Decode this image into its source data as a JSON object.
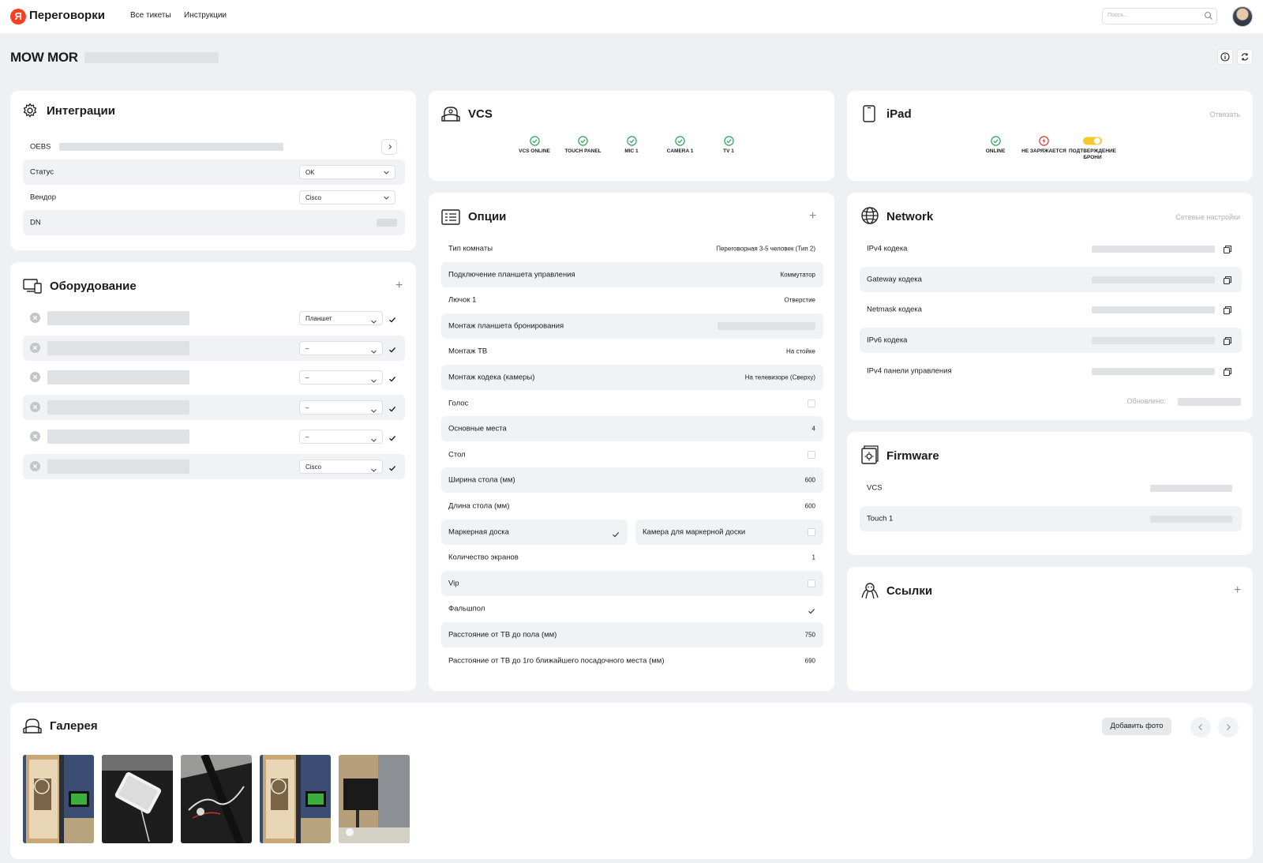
{
  "header": {
    "app_title": "Переговорки",
    "logo_letter": "Я",
    "nav": [
      "Все тикеты",
      "Инструкции"
    ],
    "search_placeholder": "Поиск..."
  },
  "page": {
    "title": "MOW MOR"
  },
  "integrations": {
    "title": "Интеграции",
    "rows": [
      {
        "label": "OEBS"
      },
      {
        "label": "Статус",
        "value": "OK"
      },
      {
        "label": "Вендор",
        "value": "Cisco"
      },
      {
        "label": "DN"
      }
    ]
  },
  "equipment": {
    "title": "Оборудование",
    "rows": [
      {
        "type": "Планшет"
      },
      {
        "type": "–"
      },
      {
        "type": "–"
      },
      {
        "type": "–"
      },
      {
        "type": "–"
      },
      {
        "type": "Cisco"
      }
    ]
  },
  "vcs": {
    "title": "VCS",
    "statuses": [
      {
        "label": "VCS ONLINE",
        "state": "ok"
      },
      {
        "label": "TOUCH PANEL",
        "state": "ok"
      },
      {
        "label": "MIC 1",
        "state": "ok"
      },
      {
        "label": "CAMERA 1",
        "state": "ok"
      },
      {
        "label": "TV 1",
        "state": "ok"
      }
    ]
  },
  "ipad": {
    "title": "iPad",
    "action": "Отвязать",
    "statuses": [
      {
        "label": "ONLINE",
        "state": "ok"
      },
      {
        "label": "НЕ ЗАРЯЖАЕТСЯ",
        "state": "error"
      },
      {
        "label": "ПОДТВЕРЖДЕНИЕ БРОНИ",
        "state": "on"
      }
    ]
  },
  "options": {
    "title": "Опции",
    "rows": [
      {
        "label": "Тип комнаты",
        "value": "Переговорная 3-5 человек (Тип 2)"
      },
      {
        "label": "Подключение планшета управления",
        "value": "Коммутатор"
      },
      {
        "label": "Лючок 1",
        "value": "Отверстие"
      },
      {
        "label": "Монтаж планшета бронирования",
        "value": ""
      },
      {
        "label": "Монтаж ТВ",
        "value": "На стойке"
      },
      {
        "label": "Монтаж кодека (камеры)",
        "value": "На телевизоре (Сверху)"
      },
      {
        "label": "Голос",
        "checked": false
      },
      {
        "label": "Основные места",
        "value": "4"
      },
      {
        "label": "Стол",
        "checked": false
      },
      {
        "label": "Ширина стола (мм)",
        "value": "600"
      },
      {
        "label": "Длина стола (мм)",
        "value": "600"
      },
      {
        "label": "Маркерная доска",
        "checked": true,
        "pair_label": "Камера для маркерной доски",
        "pair_checked": false
      },
      {
        "label": "Количество экранов",
        "value": "1"
      },
      {
        "label": "Vip",
        "checked": false
      },
      {
        "label": "Фальшпол",
        "checked": true
      },
      {
        "label": "Расстояние от ТВ до пола (мм)",
        "value": "750"
      },
      {
        "label": "Расстояние от ТВ до 1го ближайшего посадочного места (мм)",
        "value": "690"
      }
    ]
  },
  "network": {
    "title": "Network",
    "action": "Сетевые настройки",
    "rows": [
      {
        "label": "IPv4 кодека"
      },
      {
        "label": "Gateway кодека"
      },
      {
        "label": "Netmask кодека"
      },
      {
        "label": "IPv6 кодека"
      },
      {
        "label": "IPv4 панели управления"
      }
    ],
    "updated_label": "Обновлено:"
  },
  "firmware": {
    "title": "Firmware",
    "rows": [
      {
        "label": "VCS"
      },
      {
        "label": "Touch 1"
      }
    ]
  },
  "links": {
    "title": "Ссылки"
  },
  "gallery": {
    "title": "Галерея",
    "add_label": "Добавить фото",
    "photos": [
      "door-tablet",
      "tablet-desk",
      "cables",
      "door-tablet-2",
      "room-tv"
    ]
  },
  "colors": {
    "ok": "#2fa35a",
    "error": "#e5322d",
    "toggle": "#f7c72e",
    "logo": "#fc3f1d"
  }
}
